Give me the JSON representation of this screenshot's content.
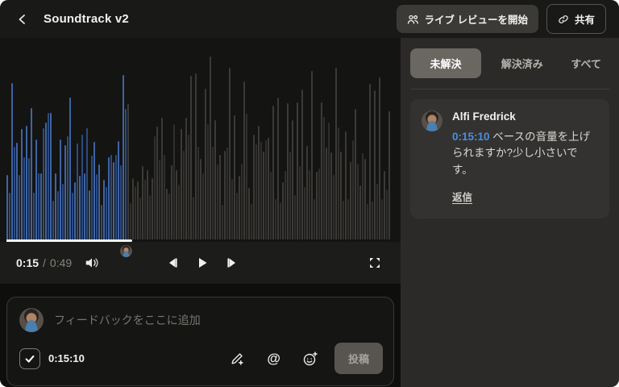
{
  "app": {
    "title": "Soundtrack v2"
  },
  "top_bar": {
    "live_review_label": "ライブ レビューを開始",
    "share_label": "共有"
  },
  "player": {
    "current_time": "0:15",
    "separator": "/",
    "duration": "0:49",
    "progress_percent": 31,
    "comment_marker_time": "0:15:10"
  },
  "comment_input": {
    "placeholder": "フィードバックをここに追加",
    "timestamp": "0:15:10",
    "checkbox_checked": true,
    "post_label": "投稿"
  },
  "sidebar": {
    "tabs": [
      {
        "label": "未解決",
        "active": true
      },
      {
        "label": "解決済み",
        "active": false
      },
      {
        "label": "すべて",
        "active": false
      }
    ],
    "comments": [
      {
        "author": "Alfi Fredrick",
        "timestamp": "0:15:10",
        "text": " ベースの音量を上げられますか?少し小さいです。",
        "reply_label": "返信"
      }
    ]
  },
  "colors": {
    "waveform_played": "#3f64a4",
    "waveform_played_alt": "#2d4b7f",
    "waveform_unplayed": "#3b3a37",
    "waveform_unplayed_alt": "#302f2d",
    "timestamp_blue": "#4a8de0",
    "active_tab_bg": "#6a6660"
  }
}
